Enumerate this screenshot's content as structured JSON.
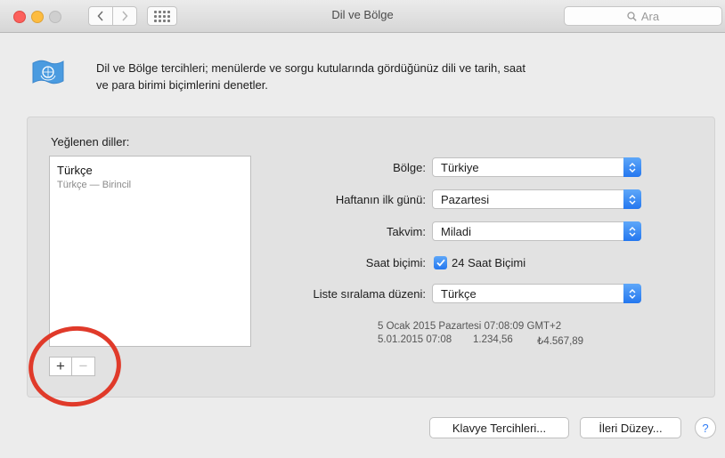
{
  "window": {
    "title": "Dil ve Bölge",
    "search_placeholder": "Ara"
  },
  "header": {
    "description_line1": "Dil ve Bölge tercihleri; menülerde ve sorgu kutularında gördüğünüz dili ve tarih, saat",
    "description_line2": "ve para birimi biçimlerini denetler."
  },
  "languages": {
    "label": "Yeğlenen diller:",
    "items": [
      {
        "name": "Türkçe",
        "detail": "Türkçe — Birincil"
      }
    ],
    "add_label": "+",
    "remove_label": "−"
  },
  "settings": {
    "region": {
      "label": "Bölge:",
      "value": "Türkiye"
    },
    "first_day": {
      "label": "Haftanın ilk günü:",
      "value": "Pazartesi"
    },
    "calendar": {
      "label": "Takvim:",
      "value": "Miladi"
    },
    "time_format": {
      "label": "Saat biçimi:",
      "checkbox_label": "24 Saat Biçimi",
      "checked": true
    },
    "sort_order": {
      "label": "Liste sıralama düzeni:",
      "value": "Türkçe"
    }
  },
  "sample": {
    "line1": "5 Ocak 2015 Pazartesi 07:08:09 GMT+2",
    "date": "5.01.2015 07:08",
    "number": "1.234,56",
    "currency": "₺4.567,89"
  },
  "footer": {
    "keyboard_button": "Klavye Tercihleri...",
    "advanced_button": "İleri Düzey...",
    "help_label": "?"
  },
  "colors": {
    "accent": "#2f7cf6",
    "annotation_circle": "#e03a2a"
  }
}
